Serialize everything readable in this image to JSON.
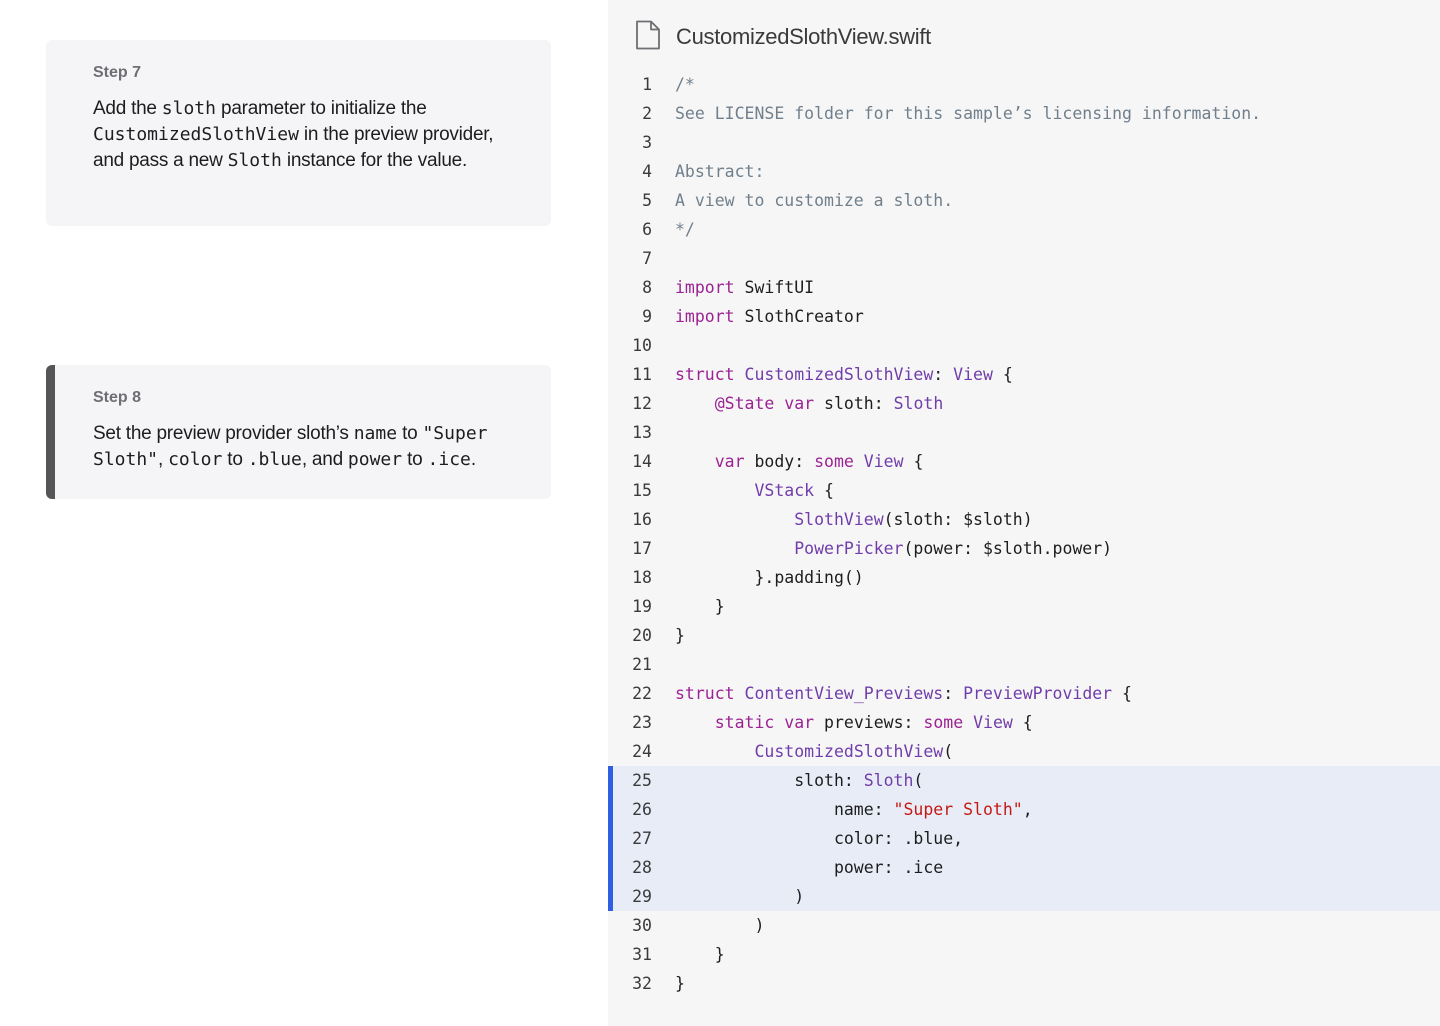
{
  "steps": [
    {
      "title": "Step 7",
      "active": false,
      "description": [
        {
          "t": "Add the "
        },
        {
          "t": "sloth",
          "code": true
        },
        {
          "t": " parameter to initialize the "
        },
        {
          "t": "CustomizedSlothView",
          "code": true
        },
        {
          "t": " in the preview provider, and pass a new "
        },
        {
          "t": "Sloth",
          "code": true
        },
        {
          "t": " instance for the value."
        }
      ]
    },
    {
      "title": "Step 8",
      "active": true,
      "description": [
        {
          "t": "Set the preview provider sloth’s "
        },
        {
          "t": "name",
          "code": true
        },
        {
          "t": " to "
        },
        {
          "t": "\"Super Sloth\"",
          "code": true
        },
        {
          "t": ", "
        },
        {
          "t": "color",
          "code": true
        },
        {
          "t": " to "
        },
        {
          "t": ".blue",
          "code": true
        },
        {
          "t": ", and "
        },
        {
          "t": "power",
          "code": true
        },
        {
          "t": " to "
        },
        {
          "t": ".ice",
          "code": true
        },
        {
          "t": "."
        }
      ]
    }
  ],
  "file": {
    "name": "CustomizedSlothView.swift",
    "icon": "file-icon"
  },
  "colors": {
    "comment": "#707f8c",
    "keyword": "#9b2393",
    "type": "#703daa",
    "string": "#c41a16",
    "highlight_bg": "#e8ecf6",
    "highlight_bar": "#2f5fe0"
  },
  "code": {
    "highlighted_lines": [
      25,
      26,
      27,
      28,
      29
    ],
    "lines": [
      [
        [
          "c",
          "/*"
        ]
      ],
      [
        [
          "c",
          "See LICENSE folder for this sample’s licensing information."
        ]
      ],
      [],
      [
        [
          "c",
          "Abstract:"
        ]
      ],
      [
        [
          "c",
          "A view to customize a sloth."
        ]
      ],
      [
        [
          "c",
          "*/"
        ]
      ],
      [],
      [
        [
          "k",
          "import"
        ],
        [
          "p",
          " SwiftUI"
        ]
      ],
      [
        [
          "k",
          "import"
        ],
        [
          "p",
          " SlothCreator"
        ]
      ],
      [],
      [
        [
          "k",
          "struct"
        ],
        [
          "p",
          " "
        ],
        [
          "t",
          "CustomizedSlothView"
        ],
        [
          "p",
          ": "
        ],
        [
          "t",
          "View"
        ],
        [
          "p",
          " {"
        ]
      ],
      [
        [
          "p",
          "    "
        ],
        [
          "k",
          "@State"
        ],
        [
          "p",
          " "
        ],
        [
          "k",
          "var"
        ],
        [
          "p",
          " sloth: "
        ],
        [
          "t",
          "Sloth"
        ]
      ],
      [],
      [
        [
          "p",
          "    "
        ],
        [
          "k",
          "var"
        ],
        [
          "p",
          " body: "
        ],
        [
          "k",
          "some"
        ],
        [
          "p",
          " "
        ],
        [
          "t",
          "View"
        ],
        [
          "p",
          " {"
        ]
      ],
      [
        [
          "p",
          "        "
        ],
        [
          "t",
          "VStack"
        ],
        [
          "p",
          " {"
        ]
      ],
      [
        [
          "p",
          "            "
        ],
        [
          "t",
          "SlothView"
        ],
        [
          "p",
          "(sloth: $sloth)"
        ]
      ],
      [
        [
          "p",
          "            "
        ],
        [
          "t",
          "PowerPicker"
        ],
        [
          "p",
          "(power: $sloth.power)"
        ]
      ],
      [
        [
          "p",
          "        }.padding()"
        ]
      ],
      [
        [
          "p",
          "    }"
        ]
      ],
      [
        [
          "p",
          "}"
        ]
      ],
      [],
      [
        [
          "k",
          "struct"
        ],
        [
          "p",
          " "
        ],
        [
          "t",
          "ContentView_Previews"
        ],
        [
          "p",
          ": "
        ],
        [
          "t",
          "PreviewProvider"
        ],
        [
          "p",
          " {"
        ]
      ],
      [
        [
          "p",
          "    "
        ],
        [
          "k",
          "static"
        ],
        [
          "p",
          " "
        ],
        [
          "k",
          "var"
        ],
        [
          "p",
          " previews: "
        ],
        [
          "k",
          "some"
        ],
        [
          "p",
          " "
        ],
        [
          "t",
          "View"
        ],
        [
          "p",
          " {"
        ]
      ],
      [
        [
          "p",
          "        "
        ],
        [
          "t",
          "CustomizedSlothView"
        ],
        [
          "p",
          "("
        ]
      ],
      [
        [
          "p",
          "            sloth: "
        ],
        [
          "t",
          "Sloth"
        ],
        [
          "p",
          "("
        ]
      ],
      [
        [
          "p",
          "                name: "
        ],
        [
          "s",
          "\"Super Sloth\""
        ],
        [
          "p",
          ","
        ]
      ],
      [
        [
          "p",
          "                color: .blue,"
        ]
      ],
      [
        [
          "p",
          "                power: .ice"
        ]
      ],
      [
        [
          "p",
          "            )"
        ]
      ],
      [
        [
          "p",
          "        )"
        ]
      ],
      [
        [
          "p",
          "    }"
        ]
      ],
      [
        [
          "p",
          "}"
        ]
      ]
    ]
  }
}
